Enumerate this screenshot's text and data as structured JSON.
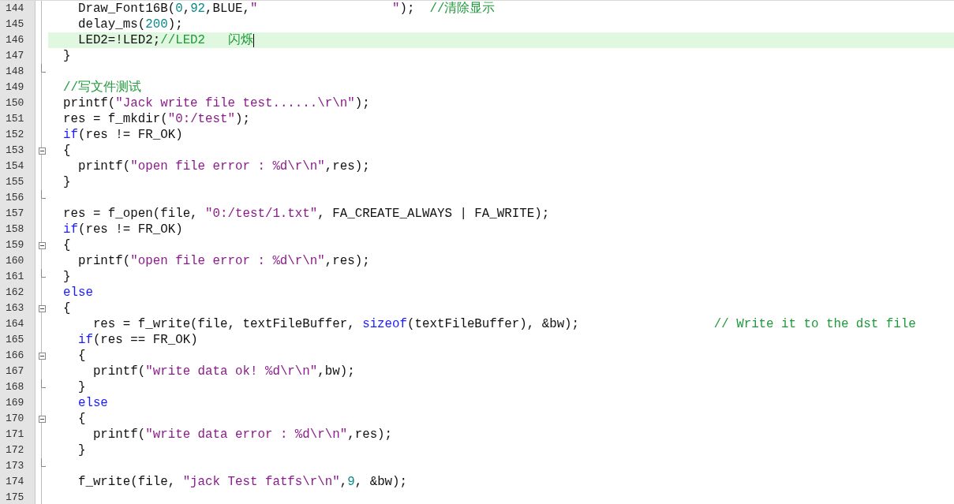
{
  "lines": [
    {
      "number": "144",
      "fold_start": false,
      "fold_end": false,
      "tokens": [
        {
          "kind": "plain",
          "text": "    Draw_Font16B("
        },
        {
          "kind": "number",
          "text": "0"
        },
        {
          "kind": "plain",
          "text": ","
        },
        {
          "kind": "number",
          "text": "92"
        },
        {
          "kind": "plain",
          "text": ",BLUE,"
        },
        {
          "kind": "string",
          "text": "\"                  \""
        },
        {
          "kind": "plain",
          "text": ");  "
        },
        {
          "kind": "comment",
          "text": "//清除显示"
        }
      ]
    },
    {
      "number": "145",
      "fold_start": false,
      "fold_end": false,
      "tokens": [
        {
          "kind": "plain",
          "text": "    delay_ms("
        },
        {
          "kind": "number",
          "text": "200"
        },
        {
          "kind": "plain",
          "text": ");"
        }
      ]
    },
    {
      "number": "146",
      "current": true,
      "fold_start": false,
      "fold_end": false,
      "tokens": [
        {
          "kind": "plain",
          "text": "    LED2=!LED2;"
        },
        {
          "kind": "comment",
          "text": "//LED2   闪烁"
        }
      ]
    },
    {
      "number": "147",
      "fold_start": false,
      "fold_end": false,
      "tokens": [
        {
          "kind": "plain",
          "text": "  }"
        }
      ]
    },
    {
      "number": "148",
      "fold_start": false,
      "fold_end": true
    },
    {
      "number": "149",
      "fold_start": false,
      "fold_end": false,
      "tokens": [
        {
          "kind": "comment",
          "text": "  //写文件测试"
        }
      ]
    },
    {
      "number": "150",
      "fold_start": false,
      "fold_end": false,
      "tokens": [
        {
          "kind": "plain",
          "text": "  printf("
        },
        {
          "kind": "string",
          "text": "\"Jack write file test......\\r\\n\""
        },
        {
          "kind": "plain",
          "text": ");"
        }
      ]
    },
    {
      "number": "151",
      "fold_start": false,
      "fold_end": false,
      "tokens": [
        {
          "kind": "plain",
          "text": "  res = f_mkdir("
        },
        {
          "kind": "string",
          "text": "\"0:/test\""
        },
        {
          "kind": "plain",
          "text": ");"
        }
      ]
    },
    {
      "number": "152",
      "fold_start": false,
      "fold_end": false,
      "tokens": [
        {
          "kind": "keyword",
          "text": "  if"
        },
        {
          "kind": "plain",
          "text": "(res != FR_OK)"
        }
      ]
    },
    {
      "number": "153",
      "fold_start": true,
      "fold_end": false,
      "tokens": [
        {
          "kind": "plain",
          "text": "  {"
        }
      ]
    },
    {
      "number": "154",
      "fold_start": false,
      "fold_end": false,
      "tokens": [
        {
          "kind": "plain",
          "text": "    printf("
        },
        {
          "kind": "string",
          "text": "\"open file error : %d\\r\\n\""
        },
        {
          "kind": "plain",
          "text": ",res);"
        }
      ]
    },
    {
      "number": "155",
      "fold_start": false,
      "fold_end": false,
      "tokens": [
        {
          "kind": "plain",
          "text": "  }"
        }
      ]
    },
    {
      "number": "156",
      "fold_start": false,
      "fold_end": true
    },
    {
      "number": "157",
      "fold_start": false,
      "fold_end": false,
      "tokens": [
        {
          "kind": "plain",
          "text": "  res = f_open(file, "
        },
        {
          "kind": "string",
          "text": "\"0:/test/1.txt\""
        },
        {
          "kind": "plain",
          "text": ", FA_CREATE_ALWAYS | FA_WRITE);"
        }
      ]
    },
    {
      "number": "158",
      "fold_start": false,
      "fold_end": false,
      "tokens": [
        {
          "kind": "keyword",
          "text": "  if"
        },
        {
          "kind": "plain",
          "text": "(res != FR_OK)"
        }
      ]
    },
    {
      "number": "159",
      "fold_start": true,
      "fold_end": false,
      "tokens": [
        {
          "kind": "plain",
          "text": "  {"
        }
      ]
    },
    {
      "number": "160",
      "fold_start": false,
      "fold_end": false,
      "tokens": [
        {
          "kind": "plain",
          "text": "    printf("
        },
        {
          "kind": "string",
          "text": "\"open file error : %d\\r\\n\""
        },
        {
          "kind": "plain",
          "text": ",res);"
        }
      ]
    },
    {
      "number": "161",
      "fold_start": false,
      "fold_end": true,
      "tokens": [
        {
          "kind": "plain",
          "text": "  }"
        }
      ]
    },
    {
      "number": "162",
      "fold_start": false,
      "fold_end": false,
      "tokens": [
        {
          "kind": "keyword",
          "text": "  else"
        }
      ]
    },
    {
      "number": "163",
      "fold_start": true,
      "fold_end": false,
      "tokens": [
        {
          "kind": "plain",
          "text": "  {"
        }
      ]
    },
    {
      "number": "164",
      "fold_start": false,
      "fold_end": false,
      "tokens": [
        {
          "kind": "plain",
          "text": "      res = f_write(file, textFileBuffer, "
        },
        {
          "kind": "keyword",
          "text": "sizeof"
        },
        {
          "kind": "plain",
          "text": "(textFileBuffer), &bw);"
        },
        {
          "kind": "comment",
          "text": "                  // Write it to the dst file"
        }
      ]
    },
    {
      "number": "165",
      "fold_start": false,
      "fold_end": false,
      "tokens": [
        {
          "kind": "keyword",
          "text": "    if"
        },
        {
          "kind": "plain",
          "text": "(res == FR_OK)"
        }
      ]
    },
    {
      "number": "166",
      "fold_start": true,
      "fold_end": false,
      "tokens": [
        {
          "kind": "plain",
          "text": "    {"
        }
      ]
    },
    {
      "number": "167",
      "fold_start": false,
      "fold_end": false,
      "tokens": [
        {
          "kind": "plain",
          "text": "      printf("
        },
        {
          "kind": "string",
          "text": "\"write data ok! %d\\r\\n\""
        },
        {
          "kind": "plain",
          "text": ",bw);"
        }
      ]
    },
    {
      "number": "168",
      "fold_start": false,
      "fold_end": true,
      "tokens": [
        {
          "kind": "plain",
          "text": "    }"
        }
      ]
    },
    {
      "number": "169",
      "fold_start": false,
      "fold_end": false,
      "tokens": [
        {
          "kind": "keyword",
          "text": "    else"
        }
      ]
    },
    {
      "number": "170",
      "fold_start": true,
      "fold_end": false,
      "tokens": [
        {
          "kind": "plain",
          "text": "    {"
        }
      ]
    },
    {
      "number": "171",
      "fold_start": false,
      "fold_end": false,
      "tokens": [
        {
          "kind": "plain",
          "text": "      printf("
        },
        {
          "kind": "string",
          "text": "\"write data error : %d\\r\\n\""
        },
        {
          "kind": "plain",
          "text": ",res);"
        }
      ]
    },
    {
      "number": "172",
      "fold_start": false,
      "fold_end": false,
      "tokens": [
        {
          "kind": "plain",
          "text": "    }"
        }
      ]
    },
    {
      "number": "173",
      "fold_start": false,
      "fold_end": true
    },
    {
      "number": "174",
      "fold_start": false,
      "fold_end": false,
      "tokens": [
        {
          "kind": "plain",
          "text": "    f_write(file, "
        },
        {
          "kind": "string",
          "text": "\"jack Test fatfs\\r\\n\""
        },
        {
          "kind": "plain",
          "text": ","
        },
        {
          "kind": "number",
          "text": "9"
        },
        {
          "kind": "plain",
          "text": ", &bw);"
        }
      ]
    },
    {
      "number": "175",
      "fold_start": false,
      "fold_end": false
    }
  ]
}
